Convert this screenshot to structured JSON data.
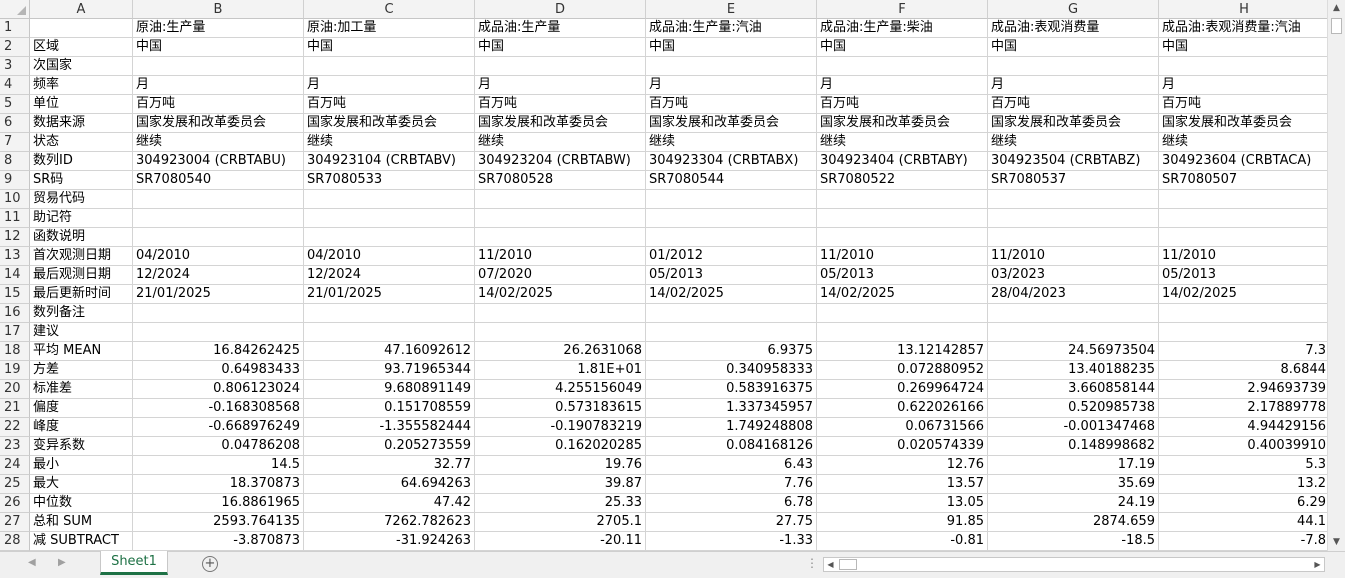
{
  "spreadsheet": {
    "columns": [
      "A",
      "B",
      "C",
      "D",
      "E",
      "F",
      "G",
      "H"
    ],
    "rows": [
      [
        "",
        "原油:生产量",
        "原油:加工量",
        "成品油:生产量",
        "成品油:生产量:汽油",
        "成品油:生产量:柴油",
        "成品油:表观消费量",
        "成品油:表观消费量:汽油"
      ],
      [
        "区域",
        "中国",
        "中国",
        "中国",
        "中国",
        "中国",
        "中国",
        "中国"
      ],
      [
        "次国家",
        "",
        "",
        "",
        "",
        "",
        "",
        ""
      ],
      [
        "频率",
        "月",
        "月",
        "月",
        "月",
        "月",
        "月",
        "月"
      ],
      [
        "单位",
        "百万吨",
        "百万吨",
        "百万吨",
        "百万吨",
        "百万吨",
        "百万吨",
        "百万吨"
      ],
      [
        "数据来源",
        "国家发展和改革委员会",
        "国家发展和改革委员会",
        "国家发展和改革委员会",
        "国家发展和改革委员会",
        "国家发展和改革委员会",
        "国家发展和改革委员会",
        "国家发展和改革委员会"
      ],
      [
        "状态",
        "继续",
        "继续",
        "继续",
        "继续",
        "继续",
        "继续",
        "继续"
      ],
      [
        "数列ID",
        "304923004 (CRBTABU)",
        "304923104 (CRBTABV)",
        "304923204 (CRBTABW)",
        "304923304 (CRBTABX)",
        "304923404 (CRBTABY)",
        "304923504 (CRBTABZ)",
        "304923604 (CRBTACA)"
      ],
      [
        "SR码",
        "SR7080540",
        "SR7080533",
        "SR7080528",
        "SR7080544",
        "SR7080522",
        "SR7080537",
        "SR7080507"
      ],
      [
        "贸易代码",
        "",
        "",
        "",
        "",
        "",
        "",
        ""
      ],
      [
        "助记符",
        "",
        "",
        "",
        "",
        "",
        "",
        ""
      ],
      [
        "函数说明",
        "",
        "",
        "",
        "",
        "",
        "",
        ""
      ],
      [
        "首次观测日期",
        "04/2010",
        "04/2010",
        "11/2010",
        "01/2012",
        "11/2010",
        "11/2010",
        "11/2010"
      ],
      [
        "最后观测日期",
        "12/2024",
        "12/2024",
        "07/2020",
        "05/2013",
        "05/2013",
        "03/2023",
        "05/2013"
      ],
      [
        "最后更新时间",
        "21/01/2025",
        "21/01/2025",
        "14/02/2025",
        "14/02/2025",
        "14/02/2025",
        "28/04/2023",
        "14/02/2025"
      ],
      [
        "数列备注",
        "",
        "",
        "",
        "",
        "",
        "",
        ""
      ],
      [
        "建议",
        "",
        "",
        "",
        "",
        "",
        "",
        ""
      ],
      [
        "平均 MEAN",
        "16.84262425",
        "47.16092612",
        "26.2631068",
        "6.9375",
        "13.12142857",
        "24.56973504",
        "7.3"
      ],
      [
        "方差",
        "0.64983433",
        "93.71965344",
        "1.81E+01",
        "0.340958333",
        "0.072880952",
        "13.40188235",
        "8.6844"
      ],
      [
        "标准差",
        "0.806123024",
        "9.680891149",
        "4.255156049",
        "0.583916375",
        "0.269964724",
        "3.660858144",
        "2.94693739"
      ],
      [
        "偏度",
        "-0.168308568",
        "0.151708559",
        "0.573183615",
        "1.337345957",
        "0.622026166",
        "0.520985738",
        "2.17889778"
      ],
      [
        "峰度",
        "-0.668976249",
        "-1.355582444",
        "-0.190783219",
        "1.749248808",
        "0.06731566",
        "-0.001347468",
        "4.94429156"
      ],
      [
        "变异系数",
        "0.04786208",
        "0.205273559",
        "0.162020285",
        "0.084168126",
        "0.020574339",
        "0.148998682",
        "0.40039910"
      ],
      [
        "最小",
        "14.5",
        "32.77",
        "19.76",
        "6.43",
        "12.76",
        "17.19",
        "5.3"
      ],
      [
        "最大",
        "18.370873",
        "64.694263",
        "39.87",
        "7.76",
        "13.57",
        "35.69",
        "13.2"
      ],
      [
        "中位数",
        "16.8861965",
        "47.42",
        "25.33",
        "6.78",
        "13.05",
        "24.19",
        "6.29"
      ],
      [
        "总和 SUM",
        "2593.764135",
        "7262.782623",
        "2705.1",
        "27.75",
        "91.85",
        "2874.659",
        "44.1"
      ],
      [
        "减 SUBTRACT",
        "-3.870873",
        "-31.924263",
        "-20.11",
        "-1.33",
        "-0.81",
        "-18.5",
        "-7.8"
      ]
    ],
    "numeric_from_row": 18
  },
  "sheet_tabs": [
    {
      "label": "Sheet1",
      "active": true
    }
  ],
  "icons": {
    "add_sheet": "plus-circle-icon",
    "scroll_up": "triangle-up-icon",
    "scroll_down": "triangle-down-icon",
    "scroll_left": "triangle-left-icon",
    "scroll_right": "triangle-right-icon",
    "tab_nav_prev": "tab-prev-icon",
    "tab_nav_next": "tab-next-icon"
  },
  "colors": {
    "accent": "#1e7145",
    "header_bg": "#f3f3f3",
    "grid_line": "#d4d4d4"
  }
}
